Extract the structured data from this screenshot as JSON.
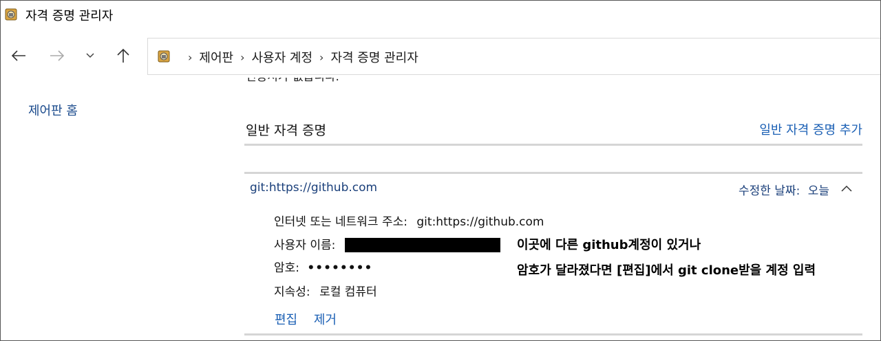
{
  "window": {
    "title": "자격 증명 관리자",
    "icon": "credential-manager-icon"
  },
  "nav": {
    "back_icon": "arrow-left-icon",
    "forward_icon": "arrow-right-icon",
    "recent_icon": "chevron-down-icon",
    "up_icon": "arrow-up-icon"
  },
  "address": {
    "crumbs": [
      "제어판",
      "사용자 계정",
      "자격 증명 관리자"
    ],
    "separator": "›"
  },
  "sidebar": {
    "home_link": "제어판 홈"
  },
  "main": {
    "cut_off_text": "인증서가 없습니다.",
    "section_title": "일반 자격 증명",
    "add_link": "일반 자격 증명 추가",
    "credential": {
      "name": "git:https://github.com",
      "modified_label": "수정한 날짜:",
      "modified_value": "오늘",
      "address_label": "인터넷 또는 네트워크 주소:",
      "address_value": "git:https://github.com",
      "username_label": "사용자 이름:",
      "password_label": "암호:",
      "password_value": "••••••••",
      "persistence_label": "지속성:",
      "persistence_value": "로컬 컴퓨터",
      "edit_link": "편집",
      "remove_link": "제거"
    }
  },
  "annotations": {
    "line1": "이곳에 다른 github계정이 있거나",
    "line2": "암호가 달라졌다면 [편집]에서 git clone받을 계정 입력"
  },
  "colors": {
    "link": "#1a5fb4",
    "credential_text": "#1a3f7a",
    "separator": "#d5d5d5"
  }
}
